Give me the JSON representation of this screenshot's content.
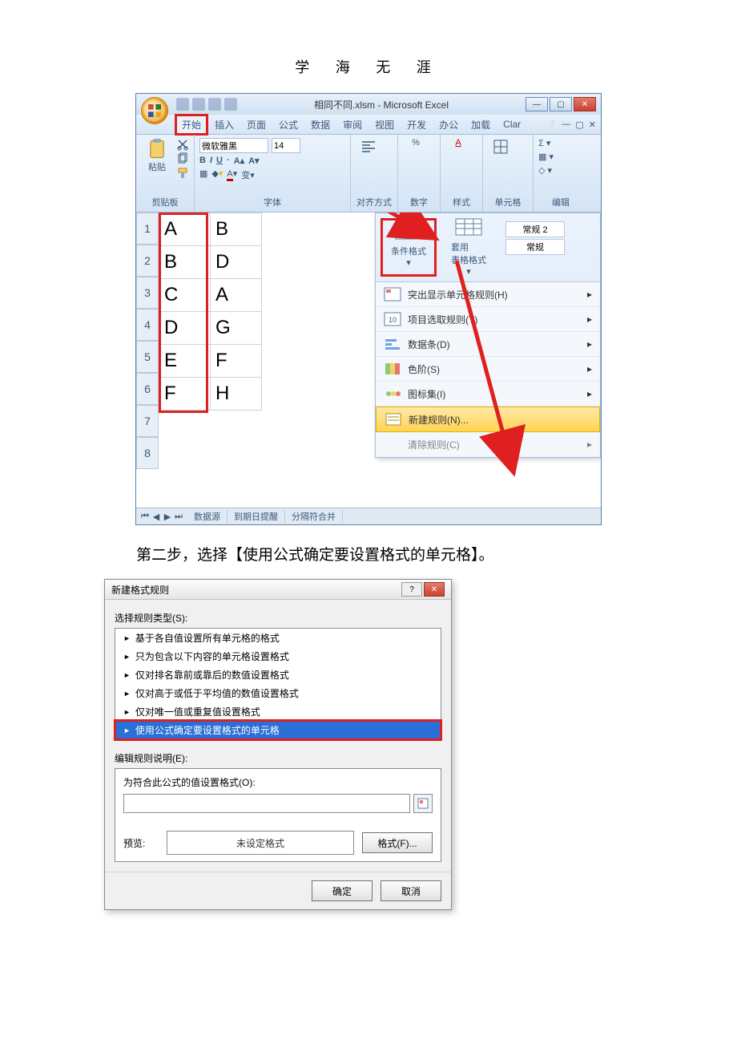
{
  "header": {
    "title": "学 海 无 涯"
  },
  "excel": {
    "title": "相同不同.xlsm - Microsoft Excel",
    "tabs": [
      "开始",
      "插入",
      "页面",
      "公式",
      "数据",
      "审阅",
      "视图",
      "开发",
      "办公",
      "加载",
      "Clar"
    ],
    "groups": {
      "clipboard": "剪贴板",
      "paste": "粘贴",
      "font": "字体",
      "fontname": "微软雅黑",
      "fontsize": "14",
      "alignment": "对齐方式",
      "number": "数字",
      "styles": "样式",
      "cells": "单元格",
      "editing": "编辑"
    },
    "rows": [
      "1",
      "2",
      "3",
      "4",
      "5",
      "6",
      "7",
      "8"
    ],
    "data": [
      [
        "A",
        "B"
      ],
      [
        "B",
        "D"
      ],
      [
        "C",
        "A"
      ],
      [
        "D",
        "G"
      ],
      [
        "E",
        "F"
      ],
      [
        "F",
        "H"
      ]
    ],
    "styles_panel": {
      "cond_format": "条件格式",
      "table_format": "套用\n表格格式",
      "preset_normal2": "常规 2",
      "preset_normal": "常规",
      "menu": {
        "highlight": "突出显示单元格规则(H)",
        "toprules": "项目选取规则(T)",
        "databars": "数据条(D)",
        "colorscales": "色阶(S)",
        "iconsets": "图标集(I)",
        "newrule": "新建规则(N)...",
        "clear": "清除规则(C)"
      }
    },
    "sheets": {
      "s1": "数据源",
      "s2": "到期日提醒",
      "s3": "分隔符合并"
    }
  },
  "caption": "第二步，选择【使用公式确定要设置格式的单元格】。",
  "dialog": {
    "title": "新建格式规则",
    "select_label": "选择规则类型(S):",
    "rules": [
      "基于各自值设置所有单元格的格式",
      "只为包含以下内容的单元格设置格式",
      "仅对排名靠前或靠后的数值设置格式",
      "仅对高于或低于平均值的数值设置格式",
      "仅对唯一值或重复值设置格式",
      "使用公式确定要设置格式的单元格"
    ],
    "edit_label": "编辑规则说明(E):",
    "formula_label": "为符合此公式的值设置格式(O):",
    "preview_label": "预览:",
    "preview_text": "未设定格式",
    "format_btn": "格式(F)...",
    "ok": "确定",
    "cancel": "取消"
  }
}
